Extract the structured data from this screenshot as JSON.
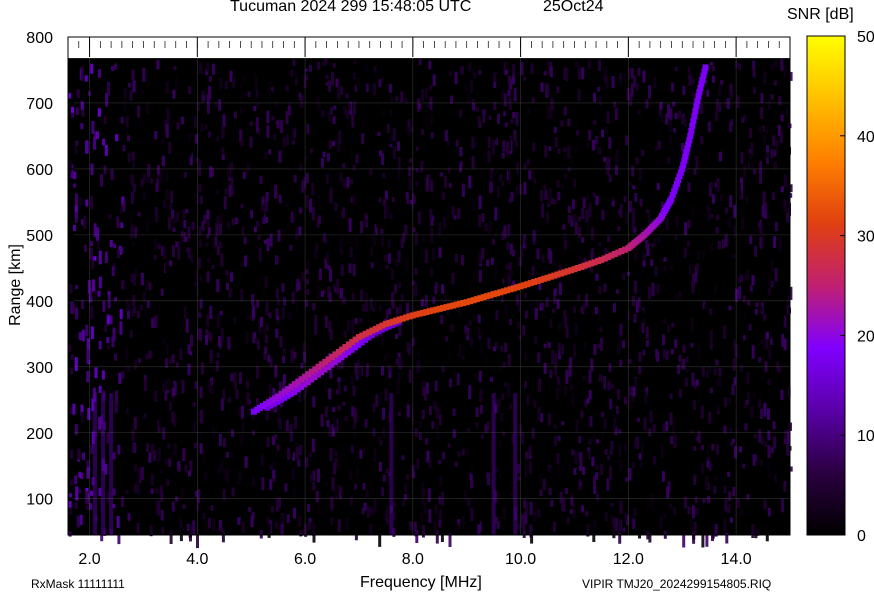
{
  "header": {
    "title": "Tucuman 2024 299 15:48:05 UTC",
    "date": "25Oct24"
  },
  "footer": {
    "rxmask": "RxMask 11111111",
    "file": "VIPIR  TMJ20_2024299154805.RIQ"
  },
  "chart_data": {
    "type": "heatmap",
    "title": "Tucuman 2024 299 15:48:05 UTC",
    "xlabel": "Frequency [MHz]",
    "ylabel": "Range [km]",
    "xlim": [
      1.6,
      15.0
    ],
    "ylim": [
      45,
      800
    ],
    "xticks": [
      2.0,
      4.0,
      6.0,
      8.0,
      10.0,
      12.0,
      14.0
    ],
    "xtick_labels": [
      "2.0",
      "4.0",
      "6.0",
      "8.0",
      "10.0",
      "12.0",
      "14.0"
    ],
    "yticks": [
      100,
      200,
      300,
      400,
      500,
      600,
      700,
      800
    ],
    "ytick_labels": [
      "100",
      "200",
      "300",
      "400",
      "500",
      "600",
      "700",
      "800"
    ],
    "grid": true,
    "colorbar": {
      "label": "SNR [dB]",
      "min": 0,
      "max": 50,
      "ticks": [
        0,
        10,
        20,
        30,
        40,
        50
      ],
      "tick_labels": [
        "0",
        "10",
        "20",
        "30",
        "40",
        "50"
      ],
      "colors": [
        "#000000",
        "#2a0040",
        "#5a00a8",
        "#8000ff",
        "#c02070",
        "#e04010",
        "#ff8000",
        "#ffc000",
        "#ffff00"
      ]
    },
    "trace_o": [
      {
        "x": 5.05,
        "y": 232
      },
      {
        "x": 5.5,
        "y": 255
      },
      {
        "x": 6.0,
        "y": 285
      },
      {
        "x": 6.5,
        "y": 315
      },
      {
        "x": 7.0,
        "y": 345
      },
      {
        "x": 7.5,
        "y": 365
      },
      {
        "x": 8.0,
        "y": 378
      },
      {
        "x": 8.5,
        "y": 388
      },
      {
        "x": 9.0,
        "y": 398
      },
      {
        "x": 9.5,
        "y": 410
      },
      {
        "x": 10.0,
        "y": 422
      },
      {
        "x": 10.5,
        "y": 435
      },
      {
        "x": 11.0,
        "y": 448
      },
      {
        "x": 11.5,
        "y": 462
      },
      {
        "x": 12.0,
        "y": 480
      },
      {
        "x": 12.3,
        "y": 500
      },
      {
        "x": 12.6,
        "y": 525
      },
      {
        "x": 12.8,
        "y": 555
      },
      {
        "x": 13.0,
        "y": 600
      },
      {
        "x": 13.15,
        "y": 650
      },
      {
        "x": 13.3,
        "y": 710
      },
      {
        "x": 13.45,
        "y": 760
      }
    ],
    "trace_x": [
      {
        "x": 5.3,
        "y": 238
      },
      {
        "x": 5.8,
        "y": 262
      },
      {
        "x": 6.3,
        "y": 292
      },
      {
        "x": 6.8,
        "y": 322
      },
      {
        "x": 7.3,
        "y": 352
      },
      {
        "x": 7.8,
        "y": 370
      }
    ]
  }
}
